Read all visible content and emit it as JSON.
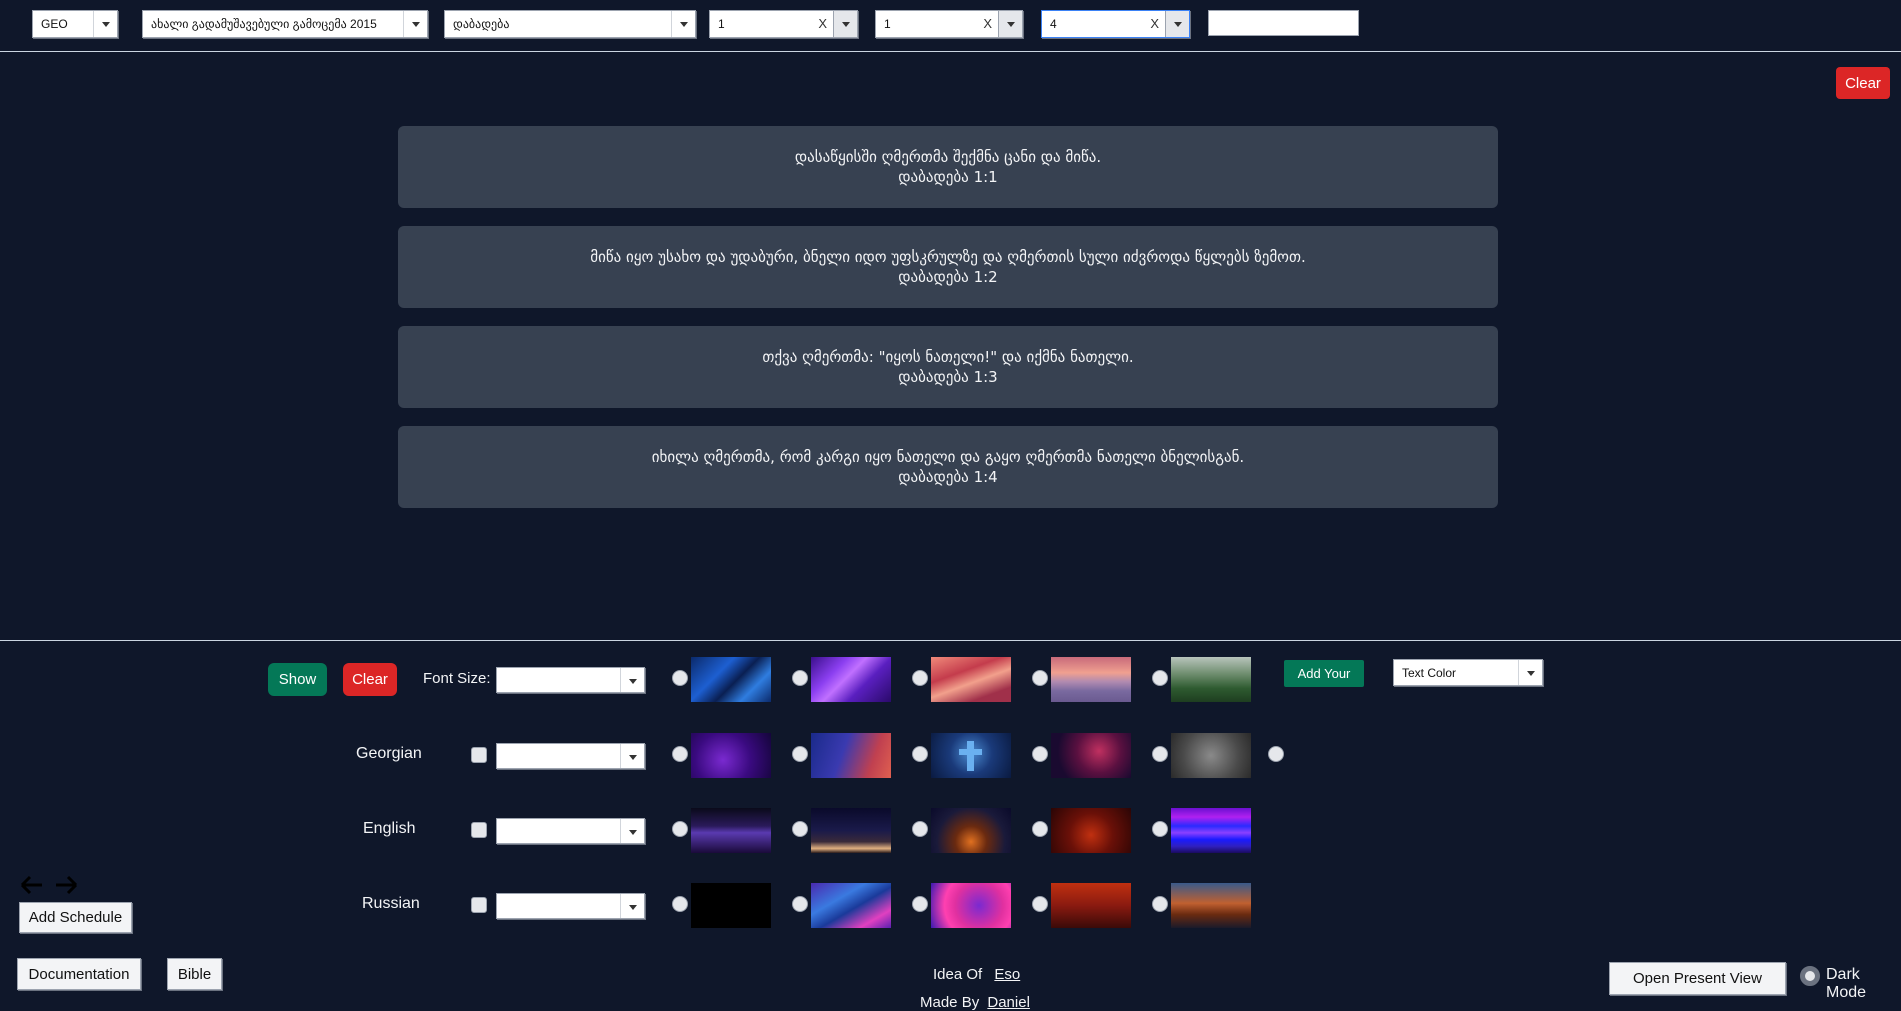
{
  "topbar": {
    "language": "GEO",
    "translation": "ახალი გადამუშავებული გამოცემა 2015",
    "book": "დაბადება",
    "chapter": "1",
    "verse_from": "1",
    "verse_to": "4",
    "clear_label": "Clear",
    "clear_icon": "x-icon"
  },
  "verses": [
    {
      "text": "დასაწყისში ღმერთმა შექმნა ცანი და მიწა.",
      "ref": "დაბადება 1:1"
    },
    {
      "text": "მიწა იყო უსახო და უდაბური, ბნელი იდო უფსკრულზე და ღმერთის სული იძვროდა წყლებს ზემოთ.",
      "ref": "დაბადება 1:2"
    },
    {
      "text": "თქვა ღმერთმა: \"იყოს ნათელი!\" და იქმნა ნათელი.",
      "ref": "დაბადება 1:3"
    },
    {
      "text": "იხილა ღმერთმა, რომ კარგი იყო ნათელი და გაყო ღმერთმა ნათელი ბნელისგან.",
      "ref": "დაბადება 1:4"
    }
  ],
  "controls": {
    "show_label": "Show",
    "clear_label": "Clear",
    "font_size_label": "Font Size:",
    "add_your_label": "Add Your",
    "text_color_label": "Text Color",
    "languages": [
      "Georgian",
      "English",
      "Russian"
    ]
  },
  "schedule": {
    "prev_icon": "arrow-left-icon",
    "next_icon": "arrow-right-icon",
    "add_schedule_label": "Add Schedule"
  },
  "footer": {
    "documentation_label": "Documentation",
    "bible_label": "Bible",
    "idea_of_label": "Idea Of",
    "idea_of_name": "Eso",
    "made_by_label": "Made By",
    "made_by_name": "Daniel",
    "open_present_label": "Open Present View",
    "dark_mode_label": "Dark Mode"
  }
}
